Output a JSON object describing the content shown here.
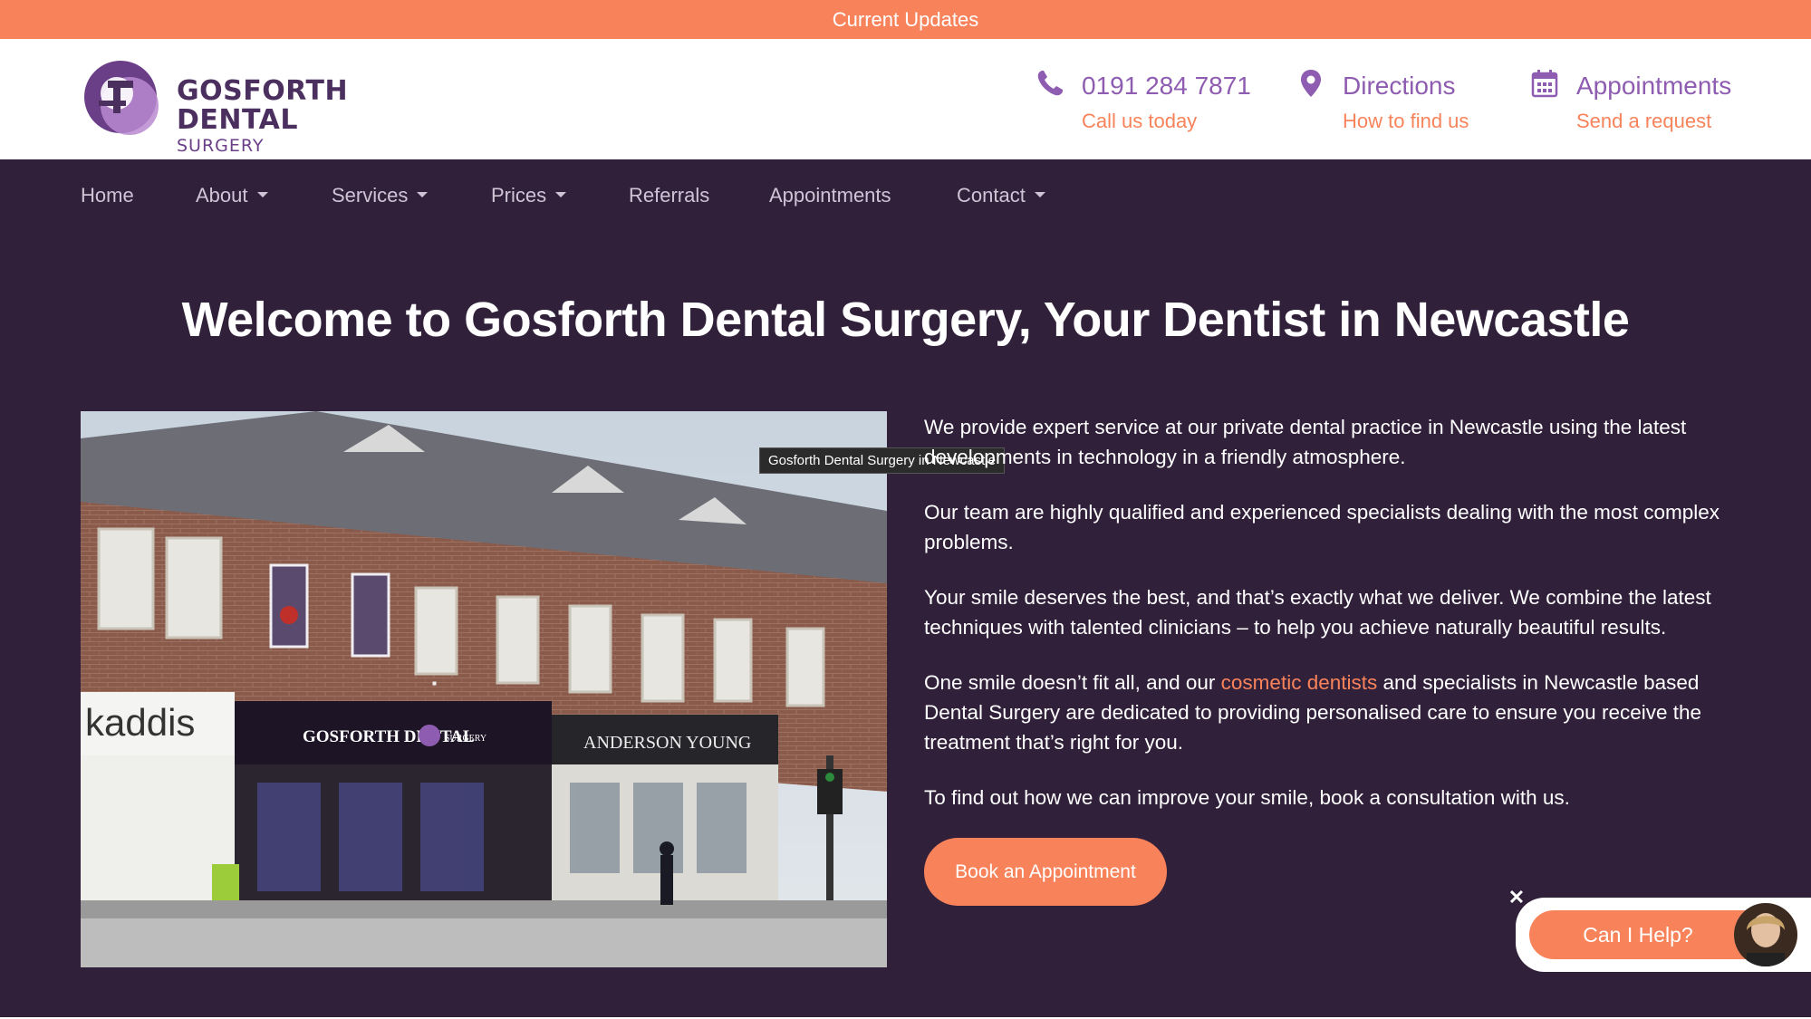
{
  "topbar": {
    "label": "Current Updates"
  },
  "logo": {
    "line1": "GOSFORTH",
    "line2": "DENTAL",
    "line3": "SURGERY"
  },
  "contacts": [
    {
      "icon": "phone-icon",
      "main": "0191 284 7871",
      "sub": "Call us today"
    },
    {
      "icon": "map-pin-icon",
      "main": "Directions",
      "sub": "How to find us"
    },
    {
      "icon": "calendar-icon",
      "main": "Appointments",
      "sub": "Send a request"
    }
  ],
  "nav": [
    {
      "label": "Home",
      "dropdown": false
    },
    {
      "label": "About",
      "dropdown": true
    },
    {
      "label": "Services",
      "dropdown": true
    },
    {
      "label": "Prices",
      "dropdown": true
    },
    {
      "label": "Referrals",
      "dropdown": false
    },
    {
      "label": "Appointments",
      "dropdown": false
    },
    {
      "label": "Contact",
      "dropdown": true
    }
  ],
  "hero": {
    "title": "Welcome to Gosforth Dental Surgery, Your Dentist in Newcastle"
  },
  "image": {
    "tooltip": "Gosforth Dental Surgery in Newcastle",
    "signs": {
      "left": "kaddis",
      "main": "GOSFORTH DENTAL",
      "surgery": "SURGERY",
      "right": "ANDERSON YOUNG"
    }
  },
  "content": {
    "p1": "We provide expert service at our private dental practice in Newcastle using the latest developments in technology in a friendly atmosphere.",
    "p2": "Our team are highly qualified and experienced specialists dealing with the most complex problems.",
    "p3": "Your smile deserves the best, and that’s exactly what we deliver. We combine the latest techniques with talented clinicians – to help you achieve naturally beautiful results.",
    "p4_before": "One smile doesn’t fit all, and our ",
    "p4_link": "cosmetic dentists",
    "p4_after": " and specialists in Newcastle based Dental Surgery are dedicated to providing personalised care to ensure you receive the treatment that’s right for you.",
    "p5": "To find out how we can improve your smile, book a consultation with us."
  },
  "cta": {
    "label": "Book an Appointment"
  },
  "chat": {
    "close": "✕",
    "label": "Can I Help?"
  },
  "colors": {
    "accent": "#f8835b",
    "brand_purple": "#8e5cb0",
    "background": "#31203a"
  }
}
